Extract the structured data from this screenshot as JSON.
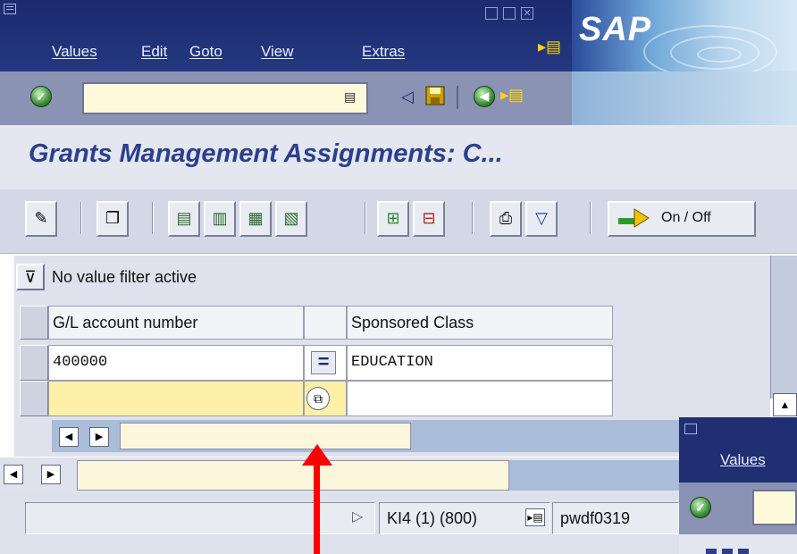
{
  "menu": {
    "items": [
      "Values",
      "Edit",
      "Goto",
      "View",
      "Extras"
    ]
  },
  "brand": {
    "logo": "SAP"
  },
  "toolbar": {
    "command_placeholder": ""
  },
  "title": {
    "text": "Grants Management Assignments: C..."
  },
  "app_toolbar": {
    "onoff_label": "On / Off"
  },
  "filter": {
    "text": "No value filter active"
  },
  "table": {
    "headers": [
      "G/L account number",
      "Sponsored Class"
    ],
    "rows": [
      {
        "gl_account": "400000",
        "operator": "=",
        "sponsored_class": "EDUCATION"
      },
      {
        "gl_account": "",
        "operator": "",
        "sponsored_class": ""
      }
    ]
  },
  "status": {
    "system": "KI4 (1) (800)",
    "server": "pwdf0319"
  },
  "second_window": {
    "menu_item": "Values"
  },
  "colors": {
    "title_bar": "#1c2a6e",
    "title_text": "#2c3f8c",
    "highlight_field": "#fff9dc",
    "annotation_arrow": "#ff0000"
  }
}
